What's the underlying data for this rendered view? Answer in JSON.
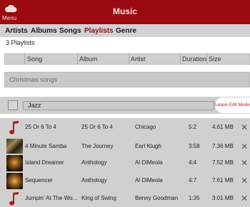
{
  "app": {
    "title": "Music",
    "menu_label": "Menu",
    "brand_color": "#9a0a10",
    "accent_color": "#c0192a"
  },
  "tabs": [
    {
      "label": "Artists",
      "active": false
    },
    {
      "label": "Albums",
      "active": false
    },
    {
      "label": "Songs",
      "active": false
    },
    {
      "label": "Playlists",
      "active": true
    },
    {
      "label": "Genre",
      "active": false
    }
  ],
  "playlist_count": "3 Playlists",
  "columns": {
    "song": "Song",
    "album": "Album",
    "artist": "Artist",
    "duration": "Duration",
    "size": "Size"
  },
  "playlists": {
    "christmas": "Christmas songs",
    "jazz": "Jazz"
  },
  "edit_button": "Leave Edit Mode",
  "songs": [
    {
      "title": "25 Or 6 To 4",
      "album": "25 Or 6 To 4",
      "artist": "Chicago",
      "duration": "5:2",
      "size": "4.61 MB",
      "icon": "music-note-icon"
    },
    {
      "title": "4 Minute Samba",
      "album": "The Journey",
      "artist": "Earl Klugh",
      "duration": "3:58",
      "size": "7.36 MB",
      "icon": "album-art"
    },
    {
      "title": "Island Dreamer",
      "album": "Anthology",
      "artist": "Al DiMeola",
      "duration": "4:4",
      "size": "7.52 MB",
      "icon": "album-art"
    },
    {
      "title": "Sequencer",
      "album": "Anthology",
      "artist": "Al DiMeola",
      "duration": "4:7",
      "size": "7.61 MB",
      "icon": "album-art"
    },
    {
      "title": "Jumpin' At The Wo...",
      "album": "King of Swing",
      "artist": "Benny Goodman",
      "duration": "1:35",
      "size": "3.01 MB",
      "icon": "music-note-icon"
    }
  ],
  "delete_glyph": "✕"
}
